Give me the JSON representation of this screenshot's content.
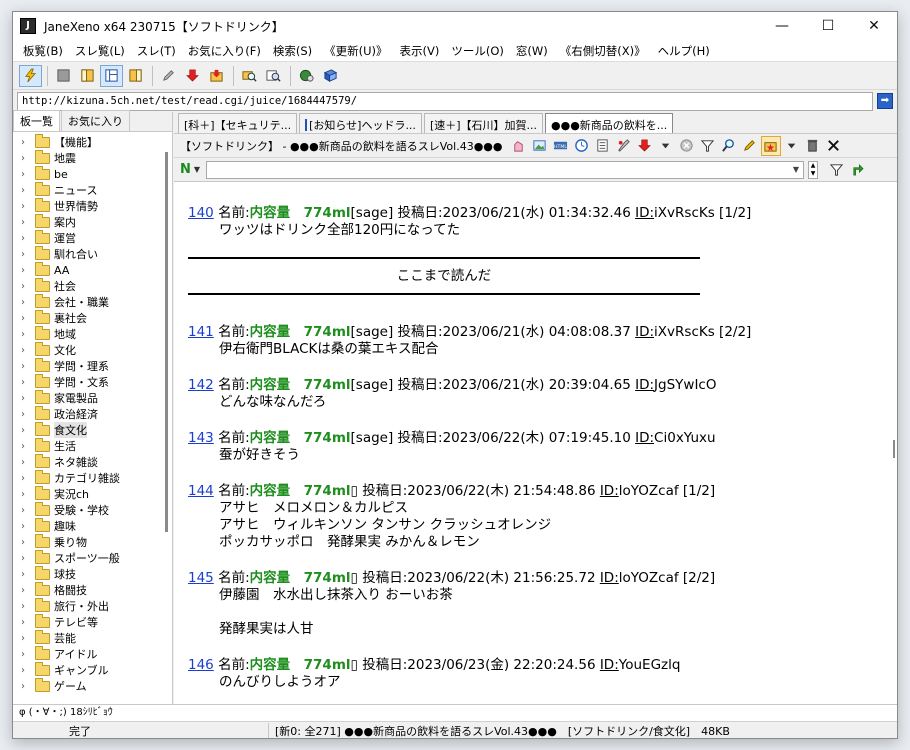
{
  "window": {
    "title": "JaneXeno x64 230715【ソフトドリンク】",
    "minimize": "—",
    "maximize": "☐",
    "close": "✕"
  },
  "menu": [
    "板覧(B)",
    "スレ覧(L)",
    "スレ(T)",
    "お気に入り(F)",
    "検索(S)",
    "《更新(U)》",
    "表示(V)",
    "ツール(O)",
    "窓(W)",
    "《右側切替(X)》",
    "ヘルプ(H)"
  ],
  "address": {
    "url": "http://kizuna.5ch.net/test/read.cgi/juice/1684447579/"
  },
  "left_tabs": [
    "板一覧",
    "お気に入り"
  ],
  "tree": [
    "【機能】",
    "地震",
    "be",
    "ニュース",
    "世界情勢",
    "案内",
    "運営",
    "馴れ合い",
    "AA",
    "社会",
    "会社・職業",
    "裏社会",
    "地域",
    "文化",
    "学問・理系",
    "学問・文系",
    "家電製品",
    "政治経済",
    "食文化",
    "生活",
    "ネタ雑談",
    "カテゴリ雑談",
    "実況ch",
    "受験・学校",
    "趣味",
    "乗り物",
    "スポーツ一般",
    "球技",
    "格闘技",
    "旅行・外出",
    "テレビ等",
    "芸能",
    "アイドル",
    "ギャンブル",
    "ゲーム"
  ],
  "selected_tree_item": "食文化",
  "tabs": [
    {
      "label": "[科＋]【セキュリテ...",
      "active": false,
      "mark": false
    },
    {
      "label": "[お知らせ]ヘッドラ...",
      "active": false,
      "mark": true
    },
    {
      "label": "[速＋]【石川】加賀...",
      "active": false,
      "mark": false
    },
    {
      "label": "●●●新商品の飲料を...",
      "active": true,
      "mark": false
    }
  ],
  "thread": {
    "title": "【ソフトドリンク】 - ●●●新商品の飲料を語るスレVol.43●●●"
  },
  "search": {
    "n_label": "N",
    "placeholder": ""
  },
  "posts": [
    {
      "num": "140",
      "name_label": "名前:",
      "name": "内容量　774ml",
      "mail": "[sage]",
      "date": " 投稿日:2023/06/21(水) 01:34:32.46 ",
      "id_label": "ID:",
      "id": "iXvRscKs",
      "count": " [1/2]",
      "body": "ワッツはドリンク全部120円になってた"
    },
    {
      "num": "141",
      "name_label": "名前:",
      "name": "内容量　774ml",
      "mail": "[sage]",
      "date": " 投稿日:2023/06/21(水) 04:08:08.37 ",
      "id_label": "ID:",
      "id": "iXvRscKs",
      "count": " [2/2]",
      "body": "伊右衛門BLACKは桑の葉エキス配合"
    },
    {
      "num": "142",
      "name_label": "名前:",
      "name": "内容量　774ml",
      "mail": "[sage]",
      "date": " 投稿日:2023/06/21(水) 20:39:04.65 ",
      "id_label": "ID:",
      "id": "JgSYwIcO",
      "count": "",
      "body": "どんな味なんだろ"
    },
    {
      "num": "143",
      "name_label": "名前:",
      "name": "内容量　774ml",
      "mail": "[sage]",
      "date": " 投稿日:2023/06/22(木) 07:19:45.10 ",
      "id_label": "ID:",
      "id": "Ci0xYuxu",
      "count": "",
      "body": "蚕が好きそう"
    },
    {
      "num": "144",
      "name_label": "名前:",
      "name": "内容量　774ml",
      "mail": "▯",
      "date": " 投稿日:2023/06/22(木) 21:54:48.86 ",
      "id_label": "ID:",
      "id": "loYOZcaf",
      "count": " [1/2]",
      "body": "アサヒ　メロメロン＆カルピス\nアサヒ　ウィルキンソン タンサン クラッシュオレンジ\nポッカサッポロ　発酵果実 みかん＆レモン"
    },
    {
      "num": "145",
      "name_label": "名前:",
      "name": "内容量　774ml",
      "mail": "▯",
      "date": " 投稿日:2023/06/22(木) 21:56:25.72 ",
      "id_label": "ID:",
      "id": "loYOZcaf",
      "count": " [2/2]",
      "body": "伊藤園　水水出し抹茶入り おーいお茶\n\n発酵果実は人甘"
    },
    {
      "num": "146",
      "name_label": "名前:",
      "name": "内容量　774ml",
      "mail": "▯",
      "date": " 投稿日:2023/06/23(金) 22:20:24.56 ",
      "id_label": "ID:",
      "id": "YouEGzlq",
      "count": "",
      "body": "のんびりしようオア"
    }
  ],
  "read_here": "ここまで読んだ",
  "status_top": "φ (・∀・;) 18ｼﾘﾋﾞｮｳ",
  "status": {
    "state": "完了",
    "info": "[新0: 全271] ●●●新商品の飲料を語るスレVol.43●●●　[ソフトドリンク/食文化]　48KB"
  }
}
